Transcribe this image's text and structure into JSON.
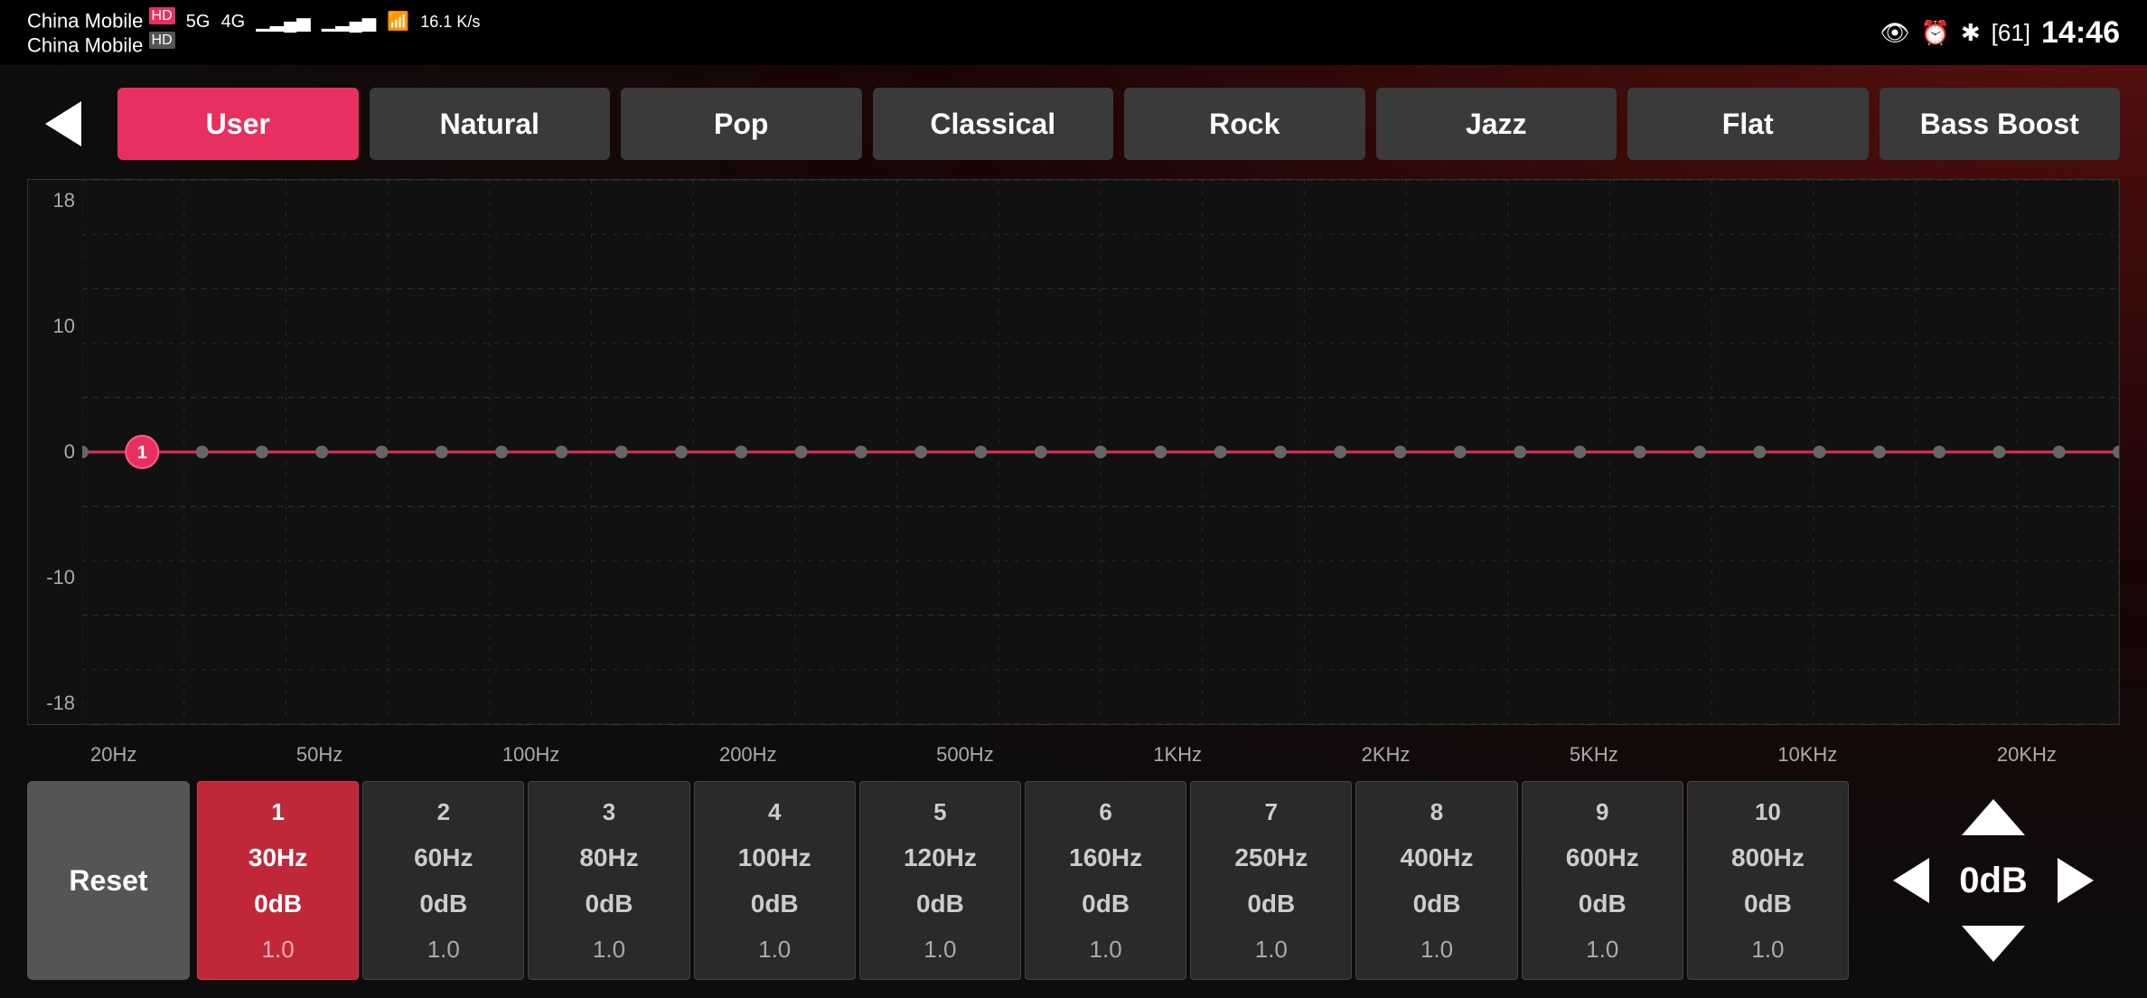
{
  "statusBar": {
    "carrier1": "China Mobile",
    "carrier1_tag": "HD",
    "network1": "5G",
    "carrier2": "China Mobile",
    "carrier2_tag": "HD",
    "data_speed": "16.1 K/s",
    "time": "14:46",
    "battery": "61"
  },
  "presets": [
    {
      "id": "user",
      "label": "User",
      "active": true
    },
    {
      "id": "natural",
      "label": "Natural",
      "active": false
    },
    {
      "id": "pop",
      "label": "Pop",
      "active": false
    },
    {
      "id": "classical",
      "label": "Classical",
      "active": false
    },
    {
      "id": "rock",
      "label": "Rock",
      "active": false
    },
    {
      "id": "jazz",
      "label": "Jazz",
      "active": false
    },
    {
      "id": "flat",
      "label": "Flat",
      "active": false
    },
    {
      "id": "bass-boost",
      "label": "Bass Boost",
      "active": false
    }
  ],
  "chart": {
    "yLabels": [
      "18",
      "10",
      "0",
      "-10",
      "-18"
    ],
    "xLabels": [
      "20Hz",
      "50Hz",
      "100Hz",
      "200Hz",
      "500Hz",
      "1KHz",
      "2KHz",
      "5KHz",
      "10KHz",
      "20KHz"
    ]
  },
  "bands": [
    {
      "number": "1",
      "freq": "30Hz",
      "db": "0dB",
      "q": "1.0",
      "active": true
    },
    {
      "number": "2",
      "freq": "60Hz",
      "db": "0dB",
      "q": "1.0",
      "active": false
    },
    {
      "number": "3",
      "freq": "80Hz",
      "db": "0dB",
      "q": "1.0",
      "active": false
    },
    {
      "number": "4",
      "freq": "100Hz",
      "db": "0dB",
      "q": "1.0",
      "active": false
    },
    {
      "number": "5",
      "freq": "120Hz",
      "db": "0dB",
      "q": "1.0",
      "active": false
    },
    {
      "number": "6",
      "freq": "160Hz",
      "db": "0dB",
      "q": "1.0",
      "active": false
    },
    {
      "number": "7",
      "freq": "250Hz",
      "db": "0dB",
      "q": "1.0",
      "active": false
    },
    {
      "number": "8",
      "freq": "400Hz",
      "db": "0dB",
      "q": "1.0",
      "active": false
    },
    {
      "number": "9",
      "freq": "600Hz",
      "db": "0dB",
      "q": "1.0",
      "active": false
    },
    {
      "number": "10",
      "freq": "800Hz",
      "db": "0dB",
      "q": "1.0",
      "active": false
    }
  ],
  "controls": {
    "reset_label": "Reset",
    "current_value": "0dB"
  },
  "colors": {
    "active_preset_bg": "#e83060",
    "active_band_bg": "#c0283a",
    "eq_line": "#e03050",
    "bg_dark": "#111111"
  }
}
